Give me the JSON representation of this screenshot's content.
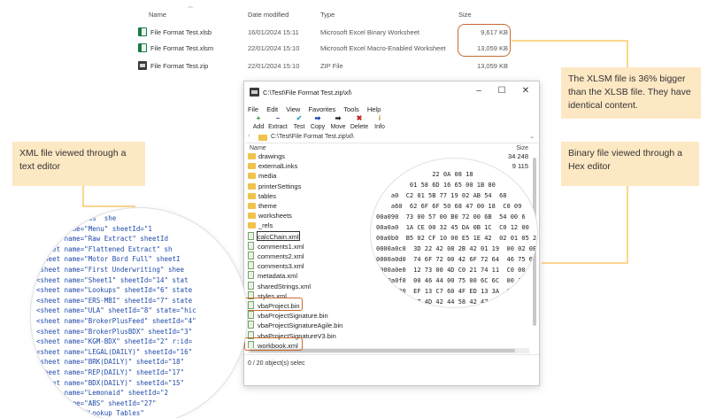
{
  "explorer": {
    "columns": {
      "name": "Name",
      "date": "Date modified",
      "type": "Type",
      "size": "Size"
    },
    "files": [
      {
        "name": "File Format Test.xlsb",
        "date": "16/01/2024 15:11",
        "type": "Microsoft Excel Binary Worksheet",
        "size": "9,617 KB",
        "icon": "excel-binary-icon"
      },
      {
        "name": "File Format Test.xlsm",
        "date": "22/01/2024 15:10",
        "type": "Microsoft Excel Macro-Enabled Worksheet",
        "size": "13,059 KB",
        "icon": "excel-macro-icon"
      },
      {
        "name": "File Format Test.zip",
        "date": "22/01/2024 15:10",
        "type": "ZIP File",
        "size": "13,059 KB",
        "icon": "zip-archive-icon"
      }
    ]
  },
  "callouts": {
    "size_note": "The XLSM file is 36% bigger than the XLSB file. They have identical content.",
    "xml_note": "XML file viewed through a text editor",
    "binary_note": "Binary file viewed through a Hex editor"
  },
  "window": {
    "title": "C:\\Test\\File Format Test.zip\\xl\\",
    "controls": {
      "minimize": "–",
      "maximize": "☐",
      "close": "✕"
    },
    "menu": [
      "File",
      "Edit",
      "View",
      "Favorites",
      "Tools",
      "Help"
    ],
    "toolbar": [
      {
        "label": "Add",
        "icon": "+",
        "color": "#1d8a2f"
      },
      {
        "label": "Extract",
        "icon": "–",
        "color": "#1b3fa8"
      },
      {
        "label": "Test",
        "icon": "✔",
        "color": "#2aa0b8"
      },
      {
        "label": "Copy",
        "icon": "➡",
        "color": "#1b3fa8"
      },
      {
        "label": "Move",
        "icon": "➡",
        "color": "#222222"
      },
      {
        "label": "Delete",
        "icon": "✖",
        "color": "#c0261d"
      },
      {
        "label": "Info",
        "icon": "i",
        "color": "#b08a10"
      }
    ],
    "address": "C:\\Test\\File Format Test.zip\\xl\\",
    "list_header": {
      "name": "Name",
      "size": "Size"
    },
    "items": [
      {
        "name": "drawings",
        "kind": "folder",
        "size": "34 248"
      },
      {
        "name": "externalLinks",
        "kind": "folder",
        "size": "9 115"
      },
      {
        "name": "media",
        "kind": "folder",
        "size": ""
      },
      {
        "name": "printerSettings",
        "kind": "folder",
        "size": ""
      },
      {
        "name": "tables",
        "kind": "folder",
        "size": ""
      },
      {
        "name": "theme",
        "kind": "folder",
        "size": ""
      },
      {
        "name": "worksheets",
        "kind": "folder",
        "size": ""
      },
      {
        "name": "_rels",
        "kind": "folder",
        "size": ""
      },
      {
        "name": "calcChain.xml",
        "kind": "file",
        "size": ""
      },
      {
        "name": "comments1.xml",
        "kind": "file",
        "size": ""
      },
      {
        "name": "comments2.xml",
        "kind": "file",
        "size": ""
      },
      {
        "name": "comments3.xml",
        "kind": "file",
        "size": ""
      },
      {
        "name": "metadata.xml",
        "kind": "file",
        "size": ""
      },
      {
        "name": "sharedStrings.xml",
        "kind": "file",
        "size": ""
      },
      {
        "name": "styles.xml",
        "kind": "file",
        "size": ""
      },
      {
        "name": "vbaProject.bin",
        "kind": "file",
        "size": ""
      },
      {
        "name": "vbaProjectSignature.bin",
        "kind": "file",
        "size": ""
      },
      {
        "name": "vbaProjectSignatureAgile.bin",
        "kind": "file",
        "size": ""
      },
      {
        "name": "vbaProjectSignatureV3.bin",
        "kind": "file",
        "size": ""
      },
      {
        "name": "workbook.xml",
        "kind": "file",
        "size": ""
      }
    ],
    "status": "0 / 20 object(s) selec"
  },
  "xml_view": [
    "         Fields  she",
    "<sheet name=\"Menu\" sheetId=\"1",
    "<sheet name=\"Raw Extract\" sheetId",
    "<sheet name=\"Flattened Extract\" sh",
    "<sheet name=\"Motor Bord Full\" sheetI",
    "<sheet name=\"First Underwriting\" shee",
    "<sheet name=\"Sheet1\" sheetId=\"14\" stat",
    "<sheet name=\"Lookups\" sheetId=\"6\" state",
    "<sheet name=\"ERS-MBI\" sheetId=\"7\" state",
    "<sheet name=\"ULA\" sheetId=\"8\" state=\"hic",
    "<sheet name=\"BrokerPlusFeed\" sheetId=\"4\"",
    "<sheet name=\"BrokerPlusBDX\" sheetId=\"3\"",
    "<sheet name=\"KGM-BDX\" sheetId=\"2\" r:id=",
    "<sheet name=\"LEGAL(DAILY)\" sheetId=\"16\"",
    "<sheet name=\"BRK(DAILY)\" sheetId=\"18\"",
    "<sheet name=\"REP(DAILY)\" sheetId=\"17\"",
    "<sheet name=\"BDX(DAILY)\" sheetId=\"15\"",
    "<sheet name=\"Lemonaid\" sheetId=\"2",
    "<sheet name=\"ABS\" sheetId=\"27\"",
    "<sheet name=\"Lookup Tables\"",
    "       name=\"Forms\" sh"
  ],
  "hex_view": [
    "               22 0A 08 18",
    "         01 58 6D 16 65 00 1B 80",
    "    a0  C2 01 5B 77 19 02 AB 54  68",
    "    a60  62 6F 6F 50 68 47 00 18  C0 09",
    "00a090  73 00 57 00 B0 72 00 6B  54 00 6",
    "00a0a0  1A CE 00 32 45 DA 0B 1C  C0 12 00",
    "00a0b0  B5 02 CF 10 00 E5 1E 42  02 01 05 2",
    "0000a0c0  3D 22 42 08 2B 42 01 19  00 02 0E C6",
    "0000a0d0  74 6F 72 00 42 6F 72 64  46 75 6C 6C",
    "0000a0e0  12 73 00 4D C0 21 74 11  C0 00 72 00",
    "0000a0f0  00 46 44 00 75 00 6C 6C  00 1A B0 06",
    "00000b00  EF 13 C7 60 4F ED 13 3A  69 EB 13 02 6",
    "00000b10  47 4D 42 44 58 42 47 C3  0E 00 48 00 4",
    "00000b20  ED 80 54 58 40 11 08 04  32 10 04 AF",
    "0000b30  7B 41 AB 0E 0D A1 0E 4C  40 34 75 50",
    "0000b40  20 70 47 20 00 00 00 B0  34 4C 40 21",
    "0000b50  70 00 D8 54 00 61 80 35  A1 8E 73 A",
    "000b60  32 5C 06 3F 13 81 A8 D7  DF 2B 13",
    "00b70  69 72 73 74 55 6E 64 65  65 72 77",
    "00b80  8C 00 24 21 16 20 34 69  00 72",
    "    90  A0 5F 64 80 90 72 00 6A  77",
    "          2F 08 32 9F 3F 08 E0",
    "             01 B6 F2"
  ]
}
